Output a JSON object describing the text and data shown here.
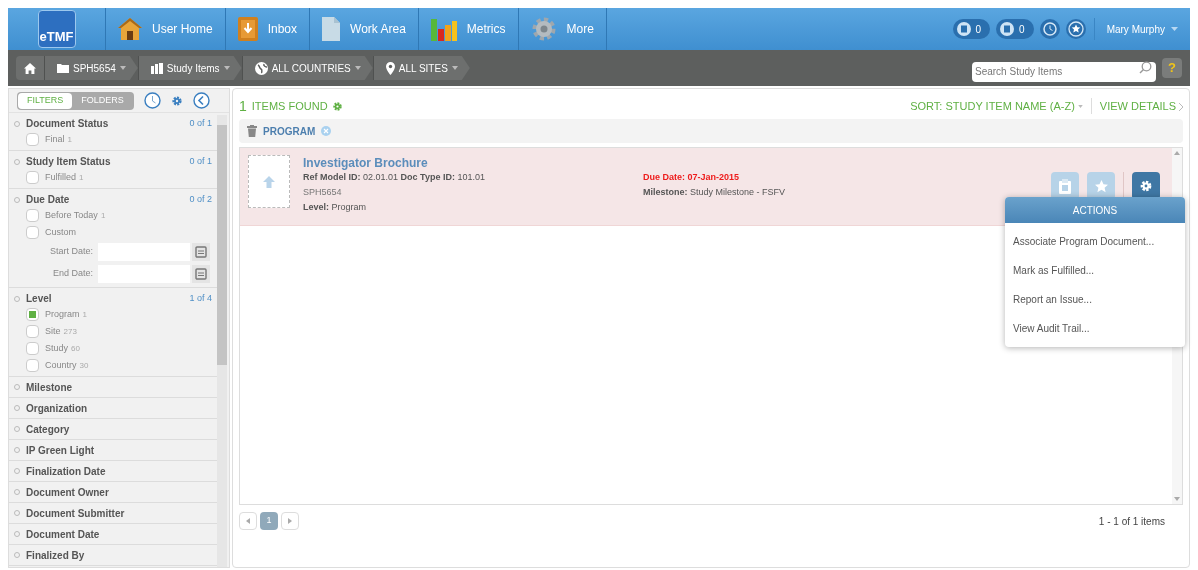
{
  "logo": {
    "text": "eTMF"
  },
  "nav": [
    {
      "label": "User Home",
      "kind": "home"
    },
    {
      "label": "Inbox",
      "kind": "inbox"
    },
    {
      "label": "Work Area",
      "kind": "doc"
    },
    {
      "label": "Metrics",
      "kind": "chart"
    },
    {
      "label": "More",
      "kind": "gear"
    }
  ],
  "badges": [
    {
      "count": "0"
    },
    {
      "count": "0"
    }
  ],
  "user": "Mary Murphy",
  "breadcrumb": [
    {
      "label": "SPH5654",
      "kind": "folder"
    },
    {
      "label": "Study Items",
      "kind": "items"
    },
    {
      "label": "ALL COUNTRIES",
      "kind": "globe"
    },
    {
      "label": "ALL SITES",
      "kind": "pin"
    }
  ],
  "search": {
    "placeholder": "Search Study Items"
  },
  "help": "?",
  "sidebar": {
    "tabs": [
      {
        "label": "FILTERS",
        "selected": true
      },
      {
        "label": "FOLDERS",
        "selected": false
      }
    ],
    "filters": [
      {
        "title": "Document Status",
        "count": "0 of 1",
        "options": [
          {
            "label": "Final",
            "count": "1",
            "checked": false
          }
        ]
      },
      {
        "title": "Study Item Status",
        "count": "0 of 1",
        "options": [
          {
            "label": "Fulfilled",
            "count": "1",
            "checked": false
          }
        ]
      },
      {
        "title": "Due Date",
        "count": "0 of 2",
        "options": [
          {
            "label": "Before Today",
            "count": "1",
            "checked": false
          },
          {
            "label": "Custom",
            "checked": false
          }
        ],
        "dates": [
          "Start Date:",
          "End Date:"
        ]
      },
      {
        "title": "Level",
        "count": "1 of 4",
        "options": [
          {
            "label": "Program",
            "count": "1",
            "checked": true
          },
          {
            "label": "Site",
            "count": "273",
            "checked": false
          },
          {
            "label": "Study",
            "count": "60",
            "checked": false
          },
          {
            "label": "Country",
            "count": "30",
            "checked": false
          }
        ]
      },
      {
        "title": "Milestone"
      },
      {
        "title": "Organization"
      },
      {
        "title": "Category"
      },
      {
        "title": "IP Green Light"
      },
      {
        "title": "Finalization Date"
      },
      {
        "title": "Document Owner"
      },
      {
        "title": "Document Submitter"
      },
      {
        "title": "Document Date"
      },
      {
        "title": "Finalized By"
      }
    ]
  },
  "results": {
    "count": "1",
    "label": "ITEMS FOUND",
    "sort": "SORT: STUDY ITEM NAME (A-Z)",
    "view": "VIEW DETAILS",
    "tag": "PROGRAM",
    "items": [
      {
        "title": "Investigator Brochure",
        "ref": "**Ref Model ID:** 02.01.01 **Doc Type ID:** 101.01",
        "study": "SPH5654",
        "level": "**Level:** Program",
        "due": "Due Date: 07-Jan-2015",
        "milestone": "**Milestone:** Study Milestone - FSFV",
        "overdue": true
      }
    ],
    "actions": {
      "title": "ACTIONS",
      "items": [
        "Associate Program Document...",
        "Mark as Fulfilled...",
        "Report an Issue...",
        "View Audit Trail..."
      ]
    },
    "pages": [
      {
        "label": "1",
        "selected": true
      }
    ],
    "summary": "1 - 1 of 1 items"
  }
}
